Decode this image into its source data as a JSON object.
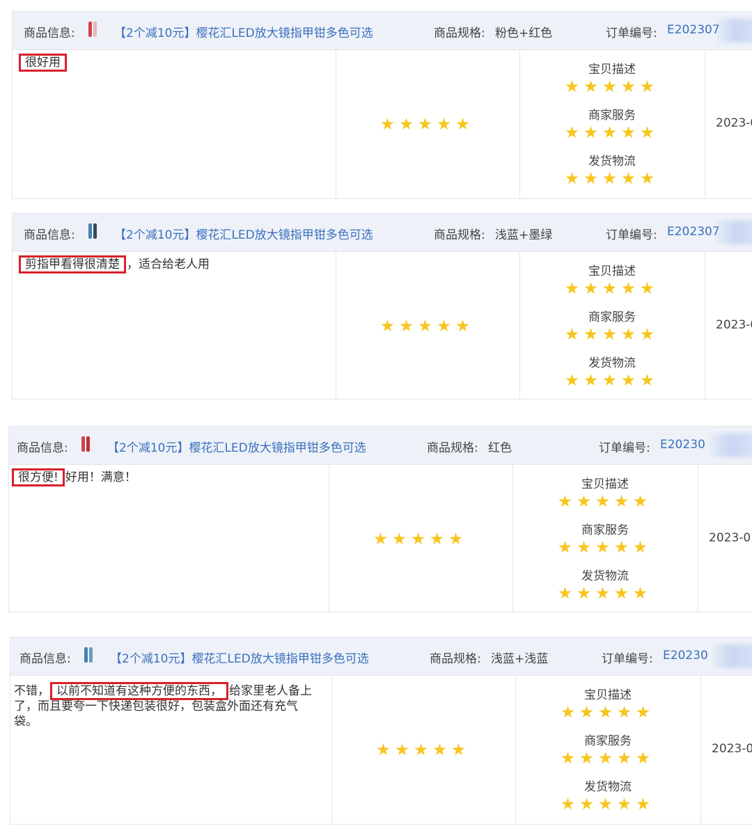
{
  "labels": {
    "product_info": "商品信息:",
    "spec": "商品规格:",
    "order": "订单编号:",
    "dims": [
      "宝贝描述",
      "商家服务",
      "发货物流"
    ]
  },
  "reviews": [
    {
      "product": "【2个减10元】樱花汇LED放大镜指甲钳多色可选",
      "spec": "粉色+红色",
      "order_no": "E202307",
      "review_highlight": "很好用",
      "review_rest": "",
      "overall_rating": 5,
      "dim_ratings": [
        5,
        5,
        5
      ],
      "date": "2023-0",
      "thumb_colors": [
        "#d0454a",
        "#e7b7b9"
      ]
    },
    {
      "product": "【2个减10元】樱花汇LED放大镜指甲钳多色可选",
      "spec": "浅蓝+墨绿",
      "order_no": "E202307",
      "review_highlight": "剪指甲看得很清楚",
      "review_rest": "，适合给老人用",
      "overall_rating": 5,
      "dim_ratings": [
        5,
        5,
        5
      ],
      "date": "2023-0",
      "thumb_colors": [
        "#4a7fb0",
        "#2f4f57"
      ]
    },
    {
      "product": "【2个减10元】樱花汇LED放大镜指甲钳多色可选",
      "spec": "红色",
      "order_no": "E20230",
      "review_highlight": "很方便!",
      "review_rest": "好用！满意！",
      "overall_rating": 5,
      "dim_ratings": [
        5,
        5,
        5
      ],
      "date": "2023-0",
      "thumb_colors": [
        "#d0454a",
        "#c03038"
      ]
    },
    {
      "product": "【2个减10元】樱花汇LED放大镜指甲钳多色可选",
      "spec": "浅蓝+浅蓝",
      "order_no": "E20230",
      "review_prefix": "不错，",
      "review_highlight": "以前不知道有这种方便的东西，",
      "review_rest": "给家里老人备上了，而且要夸一下快递包装很好，包装盒外面还有充气袋。",
      "overall_rating": 5,
      "dim_ratings": [
        5,
        5,
        5
      ],
      "date": "2023-0",
      "thumb_colors": [
        "#4a7fb0",
        "#6a9bc8"
      ]
    }
  ],
  "colors": {
    "star": "#f7c51c",
    "highlight_box": "#d9202a",
    "link": "#3a6fbf",
    "header_bg": "#eef2f8"
  }
}
